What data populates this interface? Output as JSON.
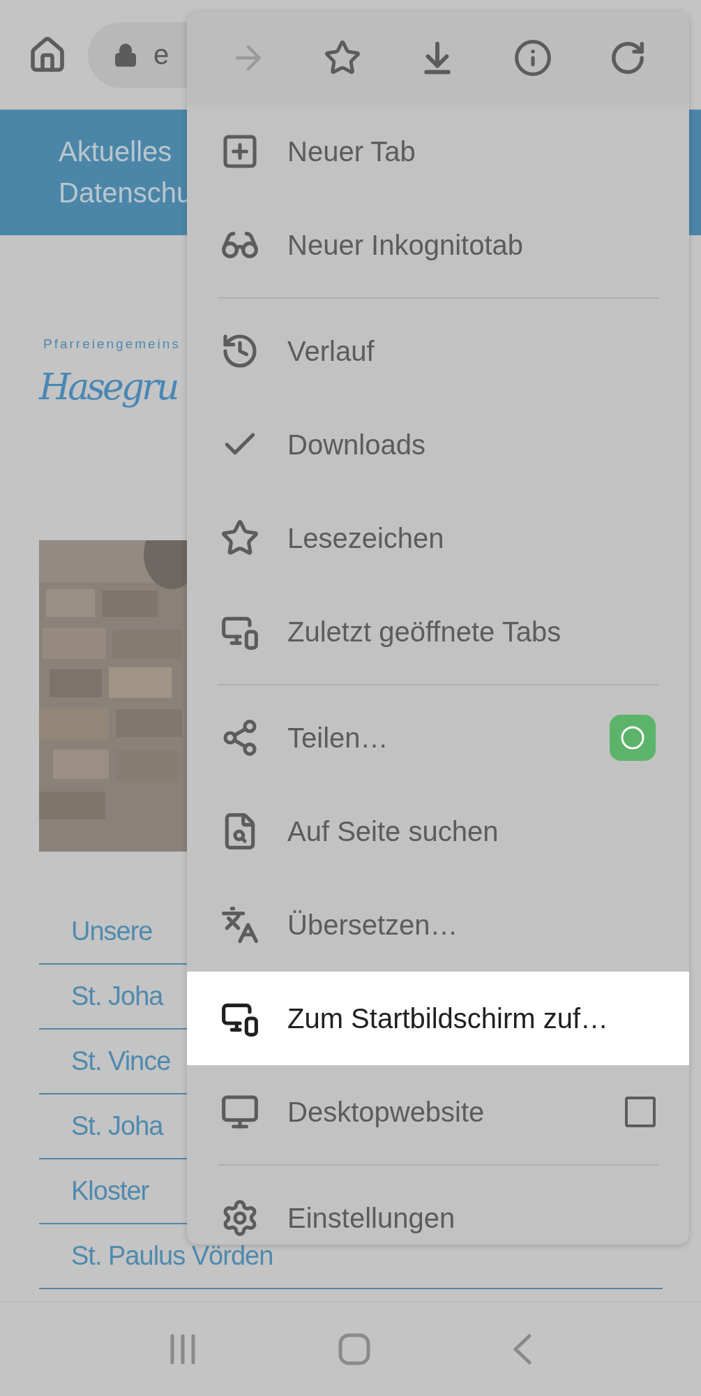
{
  "browser_bar": {
    "url_fragment": "e",
    "forward_disabled": true
  },
  "site_nav": {
    "items": [
      "Aktuelles",
      "Datenschu"
    ]
  },
  "logo": {
    "tagline": "Pfarreiengemeins",
    "name": "Hasegru"
  },
  "links": [
    "Unsere",
    "St. Joha",
    "St. Vince",
    "St. Joha",
    "Kloster",
    "St. Paulus Vörden"
  ],
  "menu": {
    "sections": [
      [
        {
          "label": "Neuer Tab",
          "kind": "plain",
          "selected": false
        },
        {
          "label": "Neuer Inkognitotab",
          "kind": "plain",
          "selected": false
        }
      ],
      [
        {
          "label": "Verlauf",
          "kind": "plain",
          "selected": false
        },
        {
          "label": "Downloads",
          "kind": "plain",
          "selected": false
        },
        {
          "label": "Lesezeichen",
          "kind": "plain",
          "selected": false
        },
        {
          "label": "Zuletzt geöffnete Tabs",
          "kind": "plain",
          "selected": false
        }
      ],
      [
        {
          "label": "Teilen…",
          "kind": "share",
          "selected": false
        },
        {
          "label": "Auf Seite suchen",
          "kind": "plain",
          "selected": false
        },
        {
          "label": "Übersetzen…",
          "kind": "plain",
          "selected": false
        },
        {
          "label": "Zum Startbildschirm zuf…",
          "kind": "plain",
          "selected": true
        },
        {
          "label": "Desktopwebsite",
          "kind": "checkbox",
          "checked": false,
          "selected": false
        }
      ],
      [
        {
          "label": "Einstellungen",
          "kind": "plain",
          "selected": false
        }
      ]
    ]
  }
}
